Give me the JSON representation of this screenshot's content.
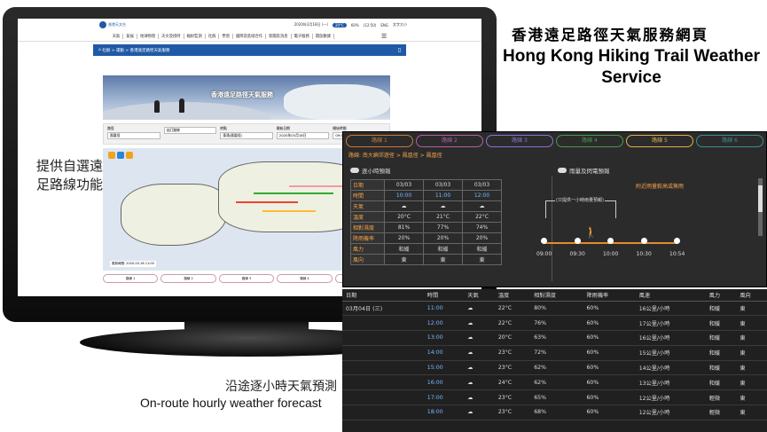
{
  "headline": {
    "zh": "香港遠足路徑天氣服務網頁",
    "en_line1": "Hong Kong Hiking Trail Weather",
    "en_line2": "Service"
  },
  "caption_left": {
    "line1": "提供自選遠",
    "line2": "足路線功能"
  },
  "caption_bottom": {
    "zh": "沿途逐小時天氣預測",
    "en": "On-route hourly weather forecast"
  },
  "screen": {
    "logo_text": "香港天文台",
    "top_info": [
      "2020年3月18日 (一)",
      "20°C",
      "60%",
      "(12:50)",
      "ENG",
      "文字大小"
    ],
    "nav": [
      "天氣",
      "氣候",
      "地球物理",
      "天文及授時",
      "輻射監測",
      "社群",
      "學習",
      "國際及區域合作",
      "新聞及消息",
      "電子服務",
      "開放數據"
    ],
    "crumb": "社群 > 運動 > 香港遠足路徑天氣服務",
    "banner_title": "香港遠足路徑天氣服務",
    "selectors": [
      {
        "label": "路徑",
        "value": "鳳凰徑"
      },
      {
        "label": "",
        "value": "自訂路線"
      },
      {
        "label": "終點",
        "value": "東涌(鳳凰徑)"
      },
      {
        "label": "開始日期",
        "value": "2020年03月18日"
      },
      {
        "label": "開始時間",
        "value": "09:00"
      }
    ],
    "map_time": "更新時間: 2020-03-18 11:00",
    "bottom_tabs": [
      "路線 1",
      "路線 2",
      "路線 3",
      "路線 4",
      "路線 5"
    ]
  },
  "panel1": {
    "tabs": [
      "路線 1",
      "路線 2",
      "路線 3",
      "路線 4",
      "路線 5",
      "路線 6"
    ],
    "tab_colors": [
      "#c97b3a",
      "#b35fa7",
      "#8a73d9",
      "#4a9a4a",
      "#e0b14a",
      "#3f8f8f"
    ],
    "route_path": "路線: 南大嶼郊遊徑 > 鳳凰徑 > 鳳凰徑",
    "hourly_title": "逐小時預報",
    "radar_title": "雨量及閃電預報",
    "radar_note": "附近雨量較高或無雨",
    "bracket_note": "(只提供一小時雨量預報)",
    "rows": [
      {
        "label": "日期",
        "values": [
          "03/03",
          "03/03",
          "03/03"
        ]
      },
      {
        "label": "時間",
        "values": [
          "10:00",
          "11:00",
          "12:00"
        ]
      },
      {
        "label": "天氣",
        "values": [
          "☁",
          "☁",
          "☁"
        ]
      },
      {
        "label": "溫度",
        "values": [
          "20°C",
          "21°C",
          "22°C"
        ]
      },
      {
        "label": "相對濕度",
        "values": [
          "81%",
          "77%",
          "74%"
        ]
      },
      {
        "label": "降雨機率",
        "values": [
          "20%",
          "20%",
          "20%"
        ]
      },
      {
        "label": "風力",
        "values": [
          "和緩",
          "和緩",
          "和緩"
        ]
      },
      {
        "label": "風向",
        "values": [
          "東",
          "東",
          "東"
        ]
      }
    ],
    "timeline": [
      "09:00",
      "09:30",
      "10:00",
      "10:30",
      "10:54"
    ]
  },
  "panel2": {
    "headers": [
      "日期",
      "時間",
      "天氣",
      "溫度",
      "相對濕度",
      "降雨機率",
      "風速",
      "風力",
      "風向"
    ],
    "date_cell": "03月04日 (三)",
    "rows": [
      {
        "time": "11:00",
        "weather": "☁",
        "temp": "22°C",
        "rh": "80%",
        "rain": "60%",
        "speed": "16公里/小時",
        "force": "和緩",
        "dir": "東"
      },
      {
        "time": "12:00",
        "weather": "☁",
        "temp": "22°C",
        "rh": "76%",
        "rain": "60%",
        "speed": "17公里/小時",
        "force": "和緩",
        "dir": "東"
      },
      {
        "time": "13:00",
        "weather": "☁",
        "temp": "20°C",
        "rh": "63%",
        "rain": "60%",
        "speed": "16公里/小時",
        "force": "和緩",
        "dir": "東"
      },
      {
        "time": "14:00",
        "weather": "☁",
        "temp": "23°C",
        "rh": "72%",
        "rain": "60%",
        "speed": "15公里/小時",
        "force": "和緩",
        "dir": "東"
      },
      {
        "time": "15:00",
        "weather": "☁",
        "temp": "23°C",
        "rh": "62%",
        "rain": "60%",
        "speed": "14公里/小時",
        "force": "和緩",
        "dir": "東"
      },
      {
        "time": "16:00",
        "weather": "☁",
        "temp": "24°C",
        "rh": "62%",
        "rain": "60%",
        "speed": "13公里/小時",
        "force": "和緩",
        "dir": "東"
      },
      {
        "time": "17:00",
        "weather": "☁",
        "temp": "23°C",
        "rh": "65%",
        "rain": "60%",
        "speed": "12公里/小時",
        "force": "輕微",
        "dir": "東"
      },
      {
        "time": "18:00",
        "weather": "☁",
        "temp": "23°C",
        "rh": "68%",
        "rain": "60%",
        "speed": "12公里/小時",
        "force": "輕微",
        "dir": "東"
      }
    ]
  }
}
